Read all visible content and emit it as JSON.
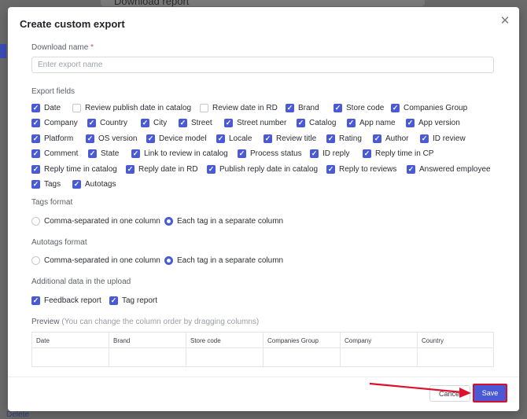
{
  "background": {
    "title": "Download report",
    "delete_label": "Delete"
  },
  "modal": {
    "title": "Create custom export",
    "close_icon": "close-icon",
    "download_name": {
      "label": "Download name",
      "required_mark": "*",
      "placeholder": "Enter export name",
      "value": ""
    },
    "export_fields": {
      "label": "Export fields",
      "rows": [
        [
          {
            "label": "Date",
            "checked": true
          },
          {
            "label": "Review publish date in catalog",
            "checked": false
          },
          {
            "label": "Review date in RD",
            "checked": false
          },
          {
            "label": "Brand",
            "checked": true
          },
          {
            "label": "Store code",
            "checked": true
          },
          {
            "label": "Companies Group",
            "checked": true
          }
        ],
        [
          {
            "label": "Company",
            "checked": true
          },
          {
            "label": "Country",
            "checked": true
          },
          {
            "label": "City",
            "checked": true
          },
          {
            "label": "Street",
            "checked": true
          },
          {
            "label": "Street number",
            "checked": true
          },
          {
            "label": "Catalog",
            "checked": true
          },
          {
            "label": "App name",
            "checked": true
          },
          {
            "label": "App version",
            "checked": true
          }
        ],
        [
          {
            "label": "Platform",
            "checked": true
          },
          {
            "label": "OS version",
            "checked": true
          },
          {
            "label": "Device model",
            "checked": true
          },
          {
            "label": "Locale",
            "checked": true
          },
          {
            "label": "Review title",
            "checked": true
          },
          {
            "label": "Rating",
            "checked": true
          },
          {
            "label": "Author",
            "checked": true
          },
          {
            "label": "ID review",
            "checked": true
          }
        ],
        [
          {
            "label": "Comment",
            "checked": true
          },
          {
            "label": "State",
            "checked": true
          },
          {
            "label": "Link to review in catalog",
            "checked": true
          },
          {
            "label": "Process status",
            "checked": true
          },
          {
            "label": "ID reply",
            "checked": true
          },
          {
            "label": "Reply time in CP",
            "checked": true
          }
        ],
        [
          {
            "label": "Reply time in catalog",
            "checked": true
          },
          {
            "label": "Reply date in RD",
            "checked": true
          },
          {
            "label": "Publish reply date in catalog",
            "checked": true
          },
          {
            "label": "Reply to reviews",
            "checked": true
          },
          {
            "label": "Answered employee",
            "checked": true
          }
        ],
        [
          {
            "label": "Tags",
            "checked": true
          },
          {
            "label": "Autotags",
            "checked": true
          }
        ]
      ]
    },
    "tags_format": {
      "label": "Tags format",
      "options": [
        {
          "label": "Comma-separated in one column",
          "selected": false
        },
        {
          "label": "Each tag in a separate column",
          "selected": true
        }
      ]
    },
    "autotags_format": {
      "label": "Autotags format",
      "options": [
        {
          "label": "Comma-separated in one column",
          "selected": false
        },
        {
          "label": "Each tag in a separate column",
          "selected": true
        }
      ]
    },
    "additional_data": {
      "label": "Additional data in the upload",
      "items": [
        {
          "label": "Feedback report",
          "checked": true
        },
        {
          "label": "Tag report",
          "checked": true
        }
      ]
    },
    "preview": {
      "label": "Preview",
      "hint": "(You can change the column order by dragging columns)",
      "columns": [
        "Date",
        "Brand",
        "Store code",
        "Companies Group",
        "Company",
        "Country"
      ]
    },
    "footer": {
      "cancel_label": "Cancel",
      "save_label": "Save"
    }
  },
  "colors": {
    "accent": "#4a5ad6",
    "annotation": "#e0102a"
  }
}
